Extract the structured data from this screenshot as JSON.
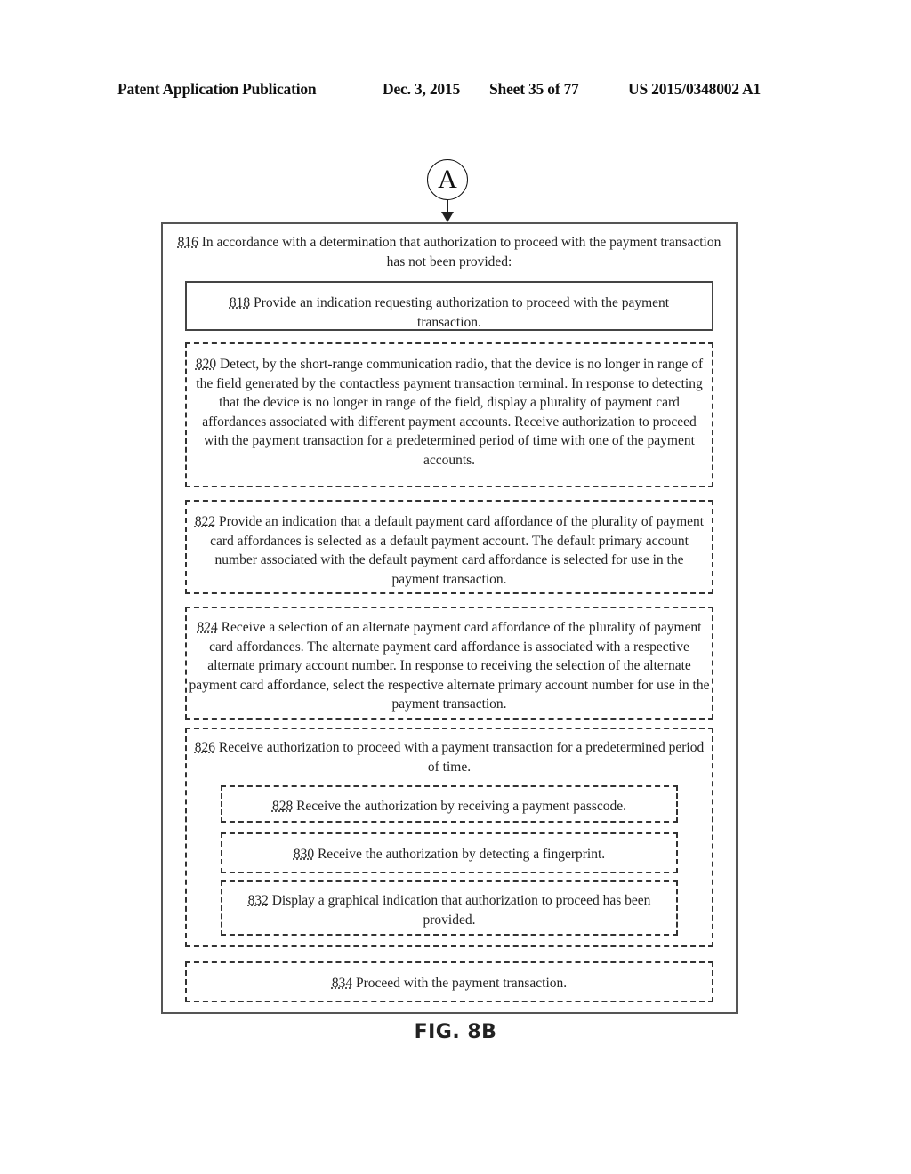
{
  "header": {
    "publication": "Patent Application Publication",
    "date": "Dec. 3, 2015",
    "sheet": "Sheet 35 of 77",
    "number": "US 2015/0348002 A1"
  },
  "connector": {
    "label": "A"
  },
  "steps": {
    "s816": {
      "num": "816",
      "text": " In accordance with a determination that authorization to proceed with the payment transaction has not been provided:"
    },
    "s818": {
      "num": "818",
      "text": " Provide an indication requesting authorization to proceed with the payment transaction."
    },
    "s820": {
      "num": "820",
      "text": " Detect, by the short-range communication radio, that the device is no longer in range of the field generated by the contactless payment transaction terminal. In response to detecting that the device is no longer in range of the field, display a plurality of payment card affordances associated with different payment accounts.  Receive authorization to proceed with the payment transaction for a predetermined period of time with one of the payment accounts."
    },
    "s822": {
      "num": "822",
      "text": " Provide an indication that a default payment card affordance of the plurality of payment card affordances is selected as a default payment account. The default primary account number associated with the default payment card affordance is selected for use in the payment transaction."
    },
    "s824": {
      "num": "824",
      "text": " Receive a selection of an alternate payment card affordance of the plurality of payment card affordances. The alternate payment card affordance is associated with a respective alternate primary account number.  In response to receiving the selection of the alternate payment card affordance, select the respective alternate primary account number for use in the payment transaction."
    },
    "s826": {
      "num": "826",
      "text": " Receive authorization to proceed with a payment transaction for a predetermined period of time."
    },
    "s828": {
      "num": "828",
      "text": " Receive the authorization by receiving a payment passcode."
    },
    "s830": {
      "num": "830",
      "text": " Receive the authorization by detecting a fingerprint."
    },
    "s832": {
      "num": "832",
      "text": " Display a graphical indication that authorization to proceed has been provided."
    },
    "s834": {
      "num": "834",
      "text": " Proceed with the payment transaction."
    }
  },
  "figure_label": "FIG. 8B"
}
